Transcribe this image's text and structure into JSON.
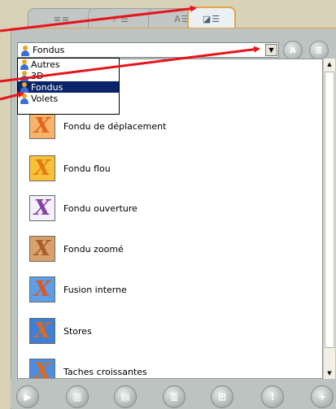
{
  "tabs": [
    {
      "glyph": "≡≡",
      "active": false
    },
    {
      "glyph": "⁄ ☰",
      "active": false
    },
    {
      "glyph": "A☰",
      "active": false
    },
    {
      "glyph": "◪☰",
      "active": true
    }
  ],
  "category_select": {
    "value": "Fondus",
    "options": [
      "Autres",
      "3D",
      "Fondus",
      "Volets"
    ],
    "selected_index": 2
  },
  "side_buttons": [
    {
      "icon": "a-icon",
      "glyph": "A"
    },
    {
      "icon": "list-icon",
      "glyph": "≣"
    }
  ],
  "effects": [
    {
      "label": "Fondu de déplacement",
      "color": "#e0641f",
      "bg": "#f7b36a"
    },
    {
      "label": "Fondu flou",
      "color": "#e37a12",
      "bg": "#f9c13a"
    },
    {
      "label": "Fondu ouverture",
      "color": "#8a3fa3",
      "bg": "#f4f0ff"
    },
    {
      "label": "Fondu zoomé",
      "color": "#a3602a",
      "bg": "#d8a06a"
    },
    {
      "label": "Fusion interne",
      "color": "#d85a22",
      "bg": "#5c9ee8"
    },
    {
      "label": "Stores",
      "color": "#dc6b1f",
      "bg": "#3f7fd6"
    },
    {
      "label": "Taches croissantes",
      "color": "#e06a1a",
      "bg": "#4d8ee0"
    }
  ],
  "toolbar_buttons": [
    {
      "icon": "play-icon",
      "glyph": "▶"
    },
    {
      "icon": "film-icon",
      "glyph": "▥"
    },
    {
      "icon": "page-icon",
      "glyph": "▤"
    },
    {
      "icon": "document-icon",
      "glyph": "≣"
    },
    {
      "icon": "grid-icon",
      "glyph": "⊞"
    },
    {
      "icon": "alert-icon",
      "glyph": "!"
    },
    {
      "icon": "add-icon",
      "glyph": "+"
    }
  ],
  "colors": {
    "arrow": "#e8141b",
    "accent_tab_border": "#e3a548",
    "selection": "#0a246a"
  }
}
